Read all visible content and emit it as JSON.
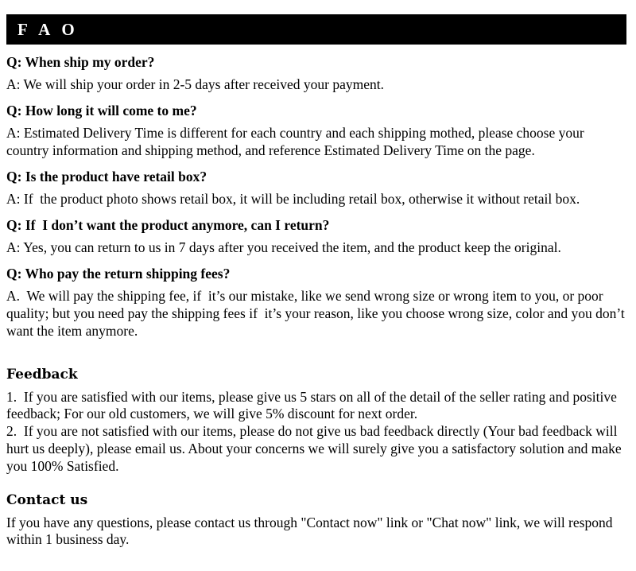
{
  "banner": {
    "title": "F A O"
  },
  "faq": {
    "items": [
      {
        "question": "Q: When ship my order?",
        "answer": "A: We will ship your order in 2-5 days after received your payment."
      },
      {
        "question": "Q: How long it will come to me?",
        "answer": "A: Estimated Delivery Time is different for each country and each shipping mothed, please choose your country information and shipping method, and reference Estimated Delivery Time on the page."
      },
      {
        "question": "Q: Is the product have retail box?",
        "answer": "A: If  the product photo shows retail box, it will be including retail box, otherwise it without retail box."
      },
      {
        "question": "Q: If  I don’t want the product anymore, can I return?",
        "answer": "A: Yes, you can return to us in 7 days after you received the item, and the product keep the original."
      },
      {
        "question": "Q: Who pay the return shipping fees?",
        "answer": "A.  We will pay the shipping fee, if  it’s our mistake, like we send wrong size or wrong item to you, or poor quality; but you need pay the shipping fees if  it’s your reason, like you choose wrong size, color and you don’t want the item anymore."
      }
    ]
  },
  "feedback": {
    "title": "Feedback",
    "body": "1.  If you are satisfied with our items, please give us 5 stars on all of the detail of the seller rating and positive feedback; For our old customers, we will give 5% discount for next order.\n2.  If you are not satisfied with our items, please do not give us bad feedback directly (Your bad feedback will hurt us deeply), please email us. About your concerns we will surely give you a satisfactory solution and make you 100% Satisfied."
  },
  "contact": {
    "title": "Contact us",
    "body": "If you have any questions, please contact us through \"Contact now\" link or \"Chat now\" link, we will respond within 1 business day."
  },
  "colors": {
    "banner_background": "#000000",
    "banner_text": "#ffffff",
    "page_background": "#ffffff",
    "body_text": "#000000"
  }
}
